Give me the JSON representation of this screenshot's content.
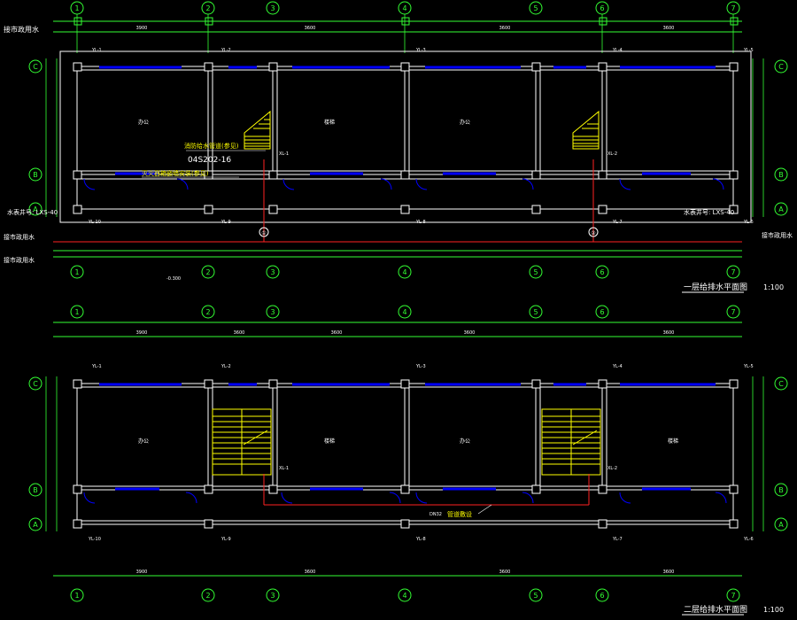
{
  "plan1": {
    "title": "一层给排水平面图",
    "scale": "1:100",
    "axes_top": [
      "1",
      "2",
      "3",
      "4",
      "5",
      "6",
      "7"
    ],
    "axes_side": [
      "C",
      "B",
      "A"
    ],
    "dims_top": [
      "3900",
      "3600",
      "3600",
      "3600",
      "3600",
      "3600"
    ],
    "left_labels": [
      "接市政用水",
      "水表井号: LXS-40",
      "接市政用水"
    ],
    "right_labels": [
      "水表井号: LXS-40",
      "接市政用水"
    ],
    "risers_top": [
      "YL-1",
      "YL-2",
      "YL-3",
      "YL-4",
      "YL-5"
    ],
    "risers_bottom": [
      "YL-10",
      "YL-9",
      "YL-8",
      "YL-7",
      "YL-6"
    ],
    "pipe_tags": [
      "XL-1",
      "XL-2"
    ],
    "room_labels": [
      "办公",
      "楼梯",
      "办公",
      "楼梯"
    ],
    "note1": "消防给水管道(参见)",
    "note2": "04S202-16",
    "note3": "灭火器箱嵌墙安装(参见)",
    "elev_note": "-0.300",
    "circle_1": "①",
    "circle_2": "②"
  },
  "plan2": {
    "title": "二层给排水平面图",
    "scale": "1:100",
    "axes_top": [
      "1",
      "2",
      "3",
      "4",
      "5",
      "6",
      "7"
    ],
    "axes_side": [
      "C",
      "B",
      "A"
    ],
    "dims_top": [
      "3900",
      "3600",
      "3600",
      "3600",
      "3600",
      "3600"
    ],
    "risers_top": [
      "YL-1",
      "YL-2",
      "YL-3",
      "YL-4",
      "YL-5"
    ],
    "risers_bottom": [
      "YL-10",
      "YL-9",
      "YL-8",
      "YL-7",
      "YL-6"
    ],
    "pipe_tags": [
      "XL-1",
      "XL-2"
    ],
    "room_labels": [
      "办公",
      "楼梯",
      "办公",
      "楼梯",
      "办公"
    ],
    "pipe_label": "DN32",
    "callout": "管道敷设"
  },
  "colors": {
    "line": "#ffffff",
    "grid": "#33ff33",
    "window": "#0000ff",
    "pipe": "#ff2020",
    "stair": "#ffff00"
  }
}
